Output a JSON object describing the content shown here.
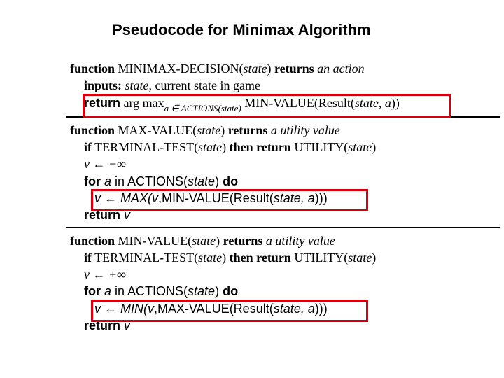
{
  "title": "Pseudocode for Minimax Algorithm",
  "fn1": {
    "head": {
      "kw": "function",
      "name": " MINIMAX-DECISION(",
      "arg": "state",
      "close": ") ",
      "ret": "returns",
      "what": " an action"
    },
    "inputs": {
      "kw": "inputs:",
      "t": " ",
      "arg": "state",
      "rest": ", current state in game"
    },
    "ret": {
      "kw": "return",
      "t1": " arg max",
      "sub": "a ∈ ACTIONS(",
      "subarg": "state",
      "subclose": ")",
      "t2": " MIN-VALUE(Result(",
      "arg": "state, a",
      "close": "))"
    }
  },
  "fn2": {
    "head": {
      "kw": "function",
      "name": " MAX-VALUE(",
      "arg": "state",
      "close": ") ",
      "ret": "returns",
      "what": " a utility value"
    },
    "if": {
      "kw1": "if",
      "t1": " TERMINAL-TEST(",
      "arg1": "state",
      "t2": ") ",
      "kw2": "then return",
      "t3": " UTILITY(",
      "arg2": "state",
      "t4": ")"
    },
    "init": "v ← −∞",
    "for": {
      "kw1": "for ",
      "a": "a",
      "t1": "  in ACTIONS(",
      "arg": "state",
      "t2": ") ",
      "kw2": "do"
    },
    "body": {
      "t1": "v ← MAX(",
      "v": "v",
      "t2": ",MIN-VALUE(Result(",
      "arg": "state, a",
      "t3": ")))"
    },
    "retline": {
      "kw": "return ",
      "v": "v"
    }
  },
  "fn3": {
    "head": {
      "kw": "function",
      "name": " MIN-VALUE(",
      "arg": "state",
      "close": ") ",
      "ret": "returns",
      "what": " a utility value"
    },
    "if": {
      "kw1": "if",
      "t1": " TERMINAL-TEST(",
      "arg1": "state",
      "t2": ") ",
      "kw2": "then return",
      "t3": " UTILITY(",
      "arg2": "state",
      "t4": ")"
    },
    "init": "v ← +∞",
    "for": {
      "kw1": "for ",
      "a": "a",
      "t1": "  in ACTIONS(",
      "arg": "state",
      "t2": ") ",
      "kw2": "do"
    },
    "body": {
      "t1": "v ← MIN(",
      "v": "v",
      "t2": ",MAX-VALUE(Result(",
      "arg": "state, a",
      "t3": ")))"
    },
    "retline": {
      "kw": "return ",
      "v": "v"
    }
  }
}
